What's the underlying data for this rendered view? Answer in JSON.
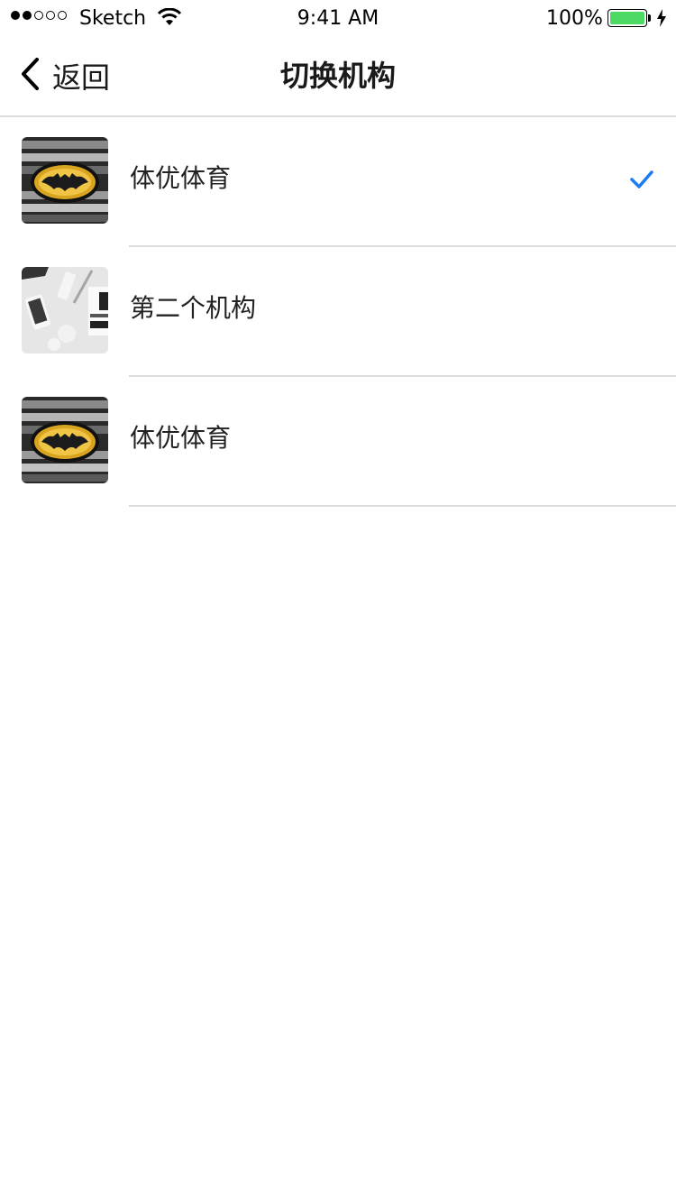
{
  "status_bar": {
    "carrier": "Sketch",
    "time": "9:41 AM",
    "battery_percent": "100%",
    "battery_level": 1.0,
    "signal_bars": 2,
    "signal_total": 5
  },
  "nav": {
    "back_label": "返回",
    "title": "切换机构",
    "back_icon": "chevron-left-icon"
  },
  "organizations": [
    {
      "name": "体优体育",
      "thumbnail": "batman-grille-logo",
      "selected": true
    },
    {
      "name": "第二个机构",
      "thumbnail": "desk-flatlay-photo",
      "selected": false
    },
    {
      "name": "体优体育",
      "thumbnail": "batman-grille-logo",
      "selected": false
    }
  ],
  "colors": {
    "accent": "#1a7cf5",
    "battery": "#4cd964",
    "divider": "#dcdcdc"
  }
}
